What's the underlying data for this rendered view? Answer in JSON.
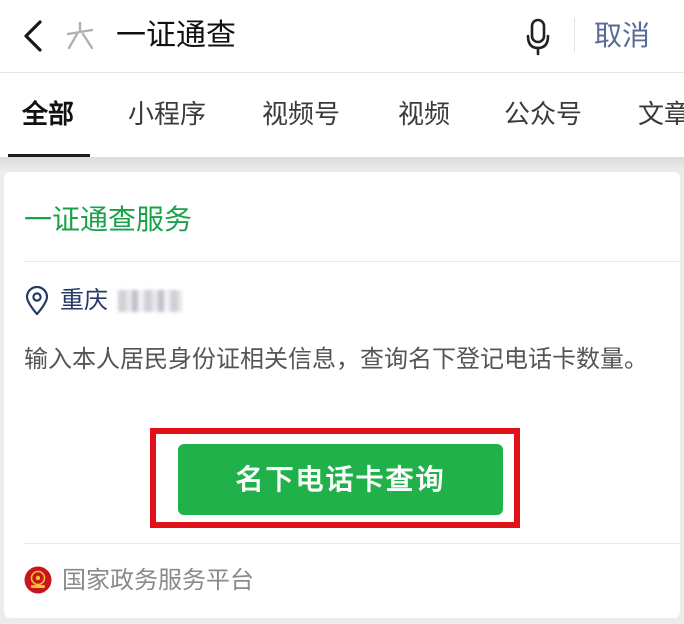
{
  "search": {
    "query": "一证通查",
    "cancel_label": "取消"
  },
  "tabs": [
    {
      "label": "全部",
      "active": true
    },
    {
      "label": "小程序",
      "active": false
    },
    {
      "label": "视频号",
      "active": false
    },
    {
      "label": "视频",
      "active": false
    },
    {
      "label": "公众号",
      "active": false
    },
    {
      "label": "文章",
      "active": false
    }
  ],
  "card": {
    "title": "一证通查服务",
    "location_city": "重庆",
    "description": "输入本人居民身份证相关信息，查询名下登记电话卡数量。",
    "button_label": "名下电话卡查询",
    "source_name": "国家政务服务平台"
  },
  "colors": {
    "accent_green": "#20b14a",
    "title_green": "#1aa24a",
    "link_blue": "#576b95",
    "highlight_red": "#e1111a",
    "location_blue": "#253a66"
  },
  "icons": [
    "back-arrow-icon",
    "weixin-search-icon",
    "microphone-icon",
    "location-pin-icon",
    "national-emblem-logo"
  ]
}
